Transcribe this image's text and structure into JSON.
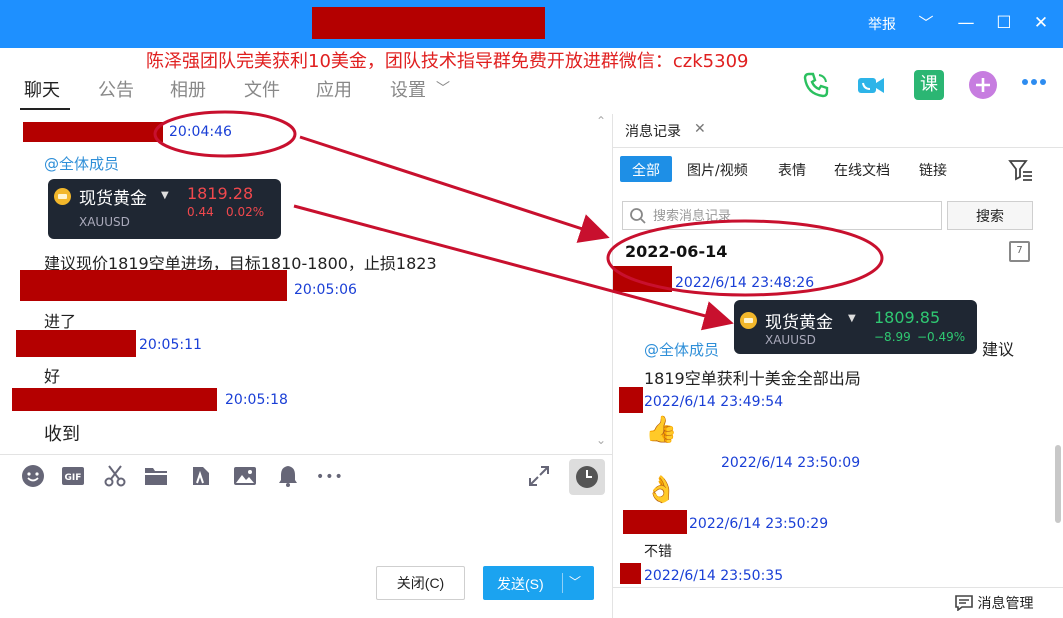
{
  "titlebar": {
    "report_label": "举报",
    "minimize_glyph": "—",
    "maximize_glyph": "☐",
    "close_glyph": "✕"
  },
  "promo_text": "陈泽强团队完美获利10美金，团队技术指导群免费开放进群微信：czk5309",
  "nav": {
    "tabs": [
      "聊天",
      "公告",
      "相册",
      "文件",
      "应用",
      "设置"
    ],
    "settings_caret": "﹀",
    "course_label": "课"
  },
  "chat": {
    "msg1_time": "20:04:46",
    "mention": "@全体成员",
    "gold_card": {
      "name": "现货黄金",
      "code": "XAUUSD",
      "price": "1819.28",
      "change": "0.44",
      "change_pct": "0.02%"
    },
    "msg1_text": "建议现价1819空单进场，目标1810-1800，止损1823",
    "msg2_time": "20:05:06",
    "msg2_text": "进了",
    "msg3_time": "20:05:11",
    "msg3_text": "好",
    "msg4_time": "20:05:18",
    "msg4_text": "收到"
  },
  "toolbar": {
    "more_glyph": "•••"
  },
  "buttons": {
    "close_label": "关闭(C)",
    "send_label": "发送(S)",
    "send_arrow": "﹀"
  },
  "history": {
    "tab_label": "消息记录",
    "tab_close": "✕",
    "filters": [
      "全部",
      "图片/视频",
      "表情",
      "在线文档",
      "链接"
    ],
    "search_placeholder": "搜索消息记录",
    "search_button": "搜索",
    "date_header": "2022-06-14",
    "calendar_num": "7",
    "entries": {
      "t1": "2022/6/14 23:48:26",
      "mention": "@全体成员",
      "gold_card": {
        "name": "现货黄金",
        "code": "XAUUSD",
        "price": "1809.85",
        "change": "−8.99",
        "change_pct": "−0.49%"
      },
      "trailing": "建议",
      "text1": "1819空单获利十美金全部出局",
      "t2": "2022/6/14 23:49:54",
      "thumbs_emoji": "👍",
      "t3": "2022/6/14 23:50:09",
      "ok_emoji": "👌",
      "t4": "2022/6/14 23:50:29",
      "text2": "不错",
      "t5": "2022/6/14 23:50:35"
    },
    "footer_button": "消息管理"
  },
  "colors": {
    "titlebar": "#1e90ff",
    "redaction": "#b40000",
    "timestamp": "#1a3fd6",
    "mention": "#2f8fd8",
    "promo": "#e02020",
    "annotation": "#c8102e",
    "price_down": "#f0484d",
    "price_up": "#2fc872"
  }
}
